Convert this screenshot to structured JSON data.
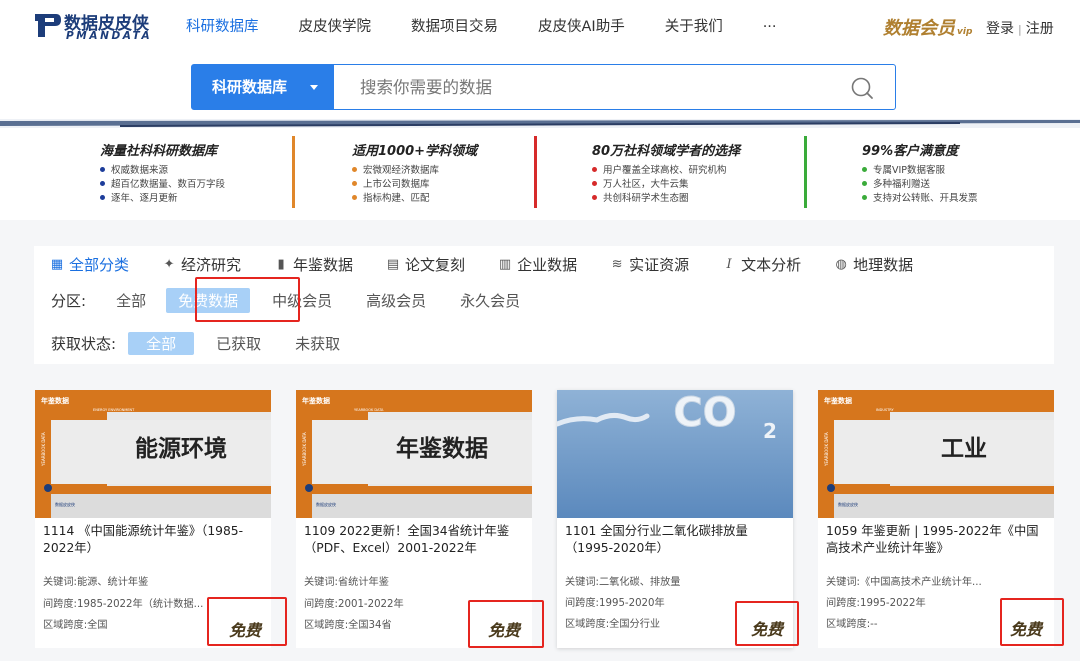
{
  "header": {
    "logo_cn": "数据皮皮侠",
    "logo_en": "PMANDATA",
    "nav": [
      "科研数据库",
      "皮皮侠学院",
      "数据项目交易",
      "皮皮侠AI助手",
      "关于我们",
      "···"
    ],
    "vip_text": "数据会员",
    "vip_sub": "vip",
    "login": "登录",
    "register": "注册"
  },
  "search": {
    "scope": "科研数据库",
    "placeholder": "搜索你需要的数据"
  },
  "features": [
    {
      "title": "海量社科科研数据库",
      "items": [
        "权威数据来源",
        "超百亿数据量、数百万字段",
        "逐年、逐月更新"
      ],
      "color": "#1d3d9a"
    },
    {
      "title": "适用1000+学科领域",
      "items": [
        "宏微观经济数据库",
        "上市公司数据库",
        "指标构建、匹配"
      ],
      "color": "#e0872a"
    },
    {
      "title": "80万社科领域学者的选择",
      "items": [
        "用户覆盖全球高校、研究机构",
        "万人社区，大牛云集",
        "共创科研学术生态圈"
      ],
      "color": "#d62a2a"
    },
    {
      "title": "99%客户满意度",
      "items": [
        "专属VIP数据客服",
        "多种福利赠送",
        "支持对公转账、开具发票"
      ],
      "color": "#3aab3a"
    }
  ],
  "categories": [
    {
      "label": "全部分类",
      "icon": "grid-icon"
    },
    {
      "label": "经济研究",
      "icon": "bulb-icon"
    },
    {
      "label": "年鉴数据",
      "icon": "book-icon"
    },
    {
      "label": "论文复刻",
      "icon": "document-icon"
    },
    {
      "label": "企业数据",
      "icon": "building-icon"
    },
    {
      "label": "实证资源",
      "icon": "layers-icon"
    },
    {
      "label": "文本分析",
      "icon": "text-cursor-icon"
    },
    {
      "label": "地理数据",
      "icon": "globe-icon"
    }
  ],
  "filters": {
    "zone_label": "分区:",
    "zone_options": [
      "全部",
      "免费数据",
      "中级会员",
      "高级会员",
      "永久会员"
    ],
    "status_label": "获取状态:",
    "status_options": [
      "全部",
      "已获取",
      "未获取"
    ]
  },
  "cards": [
    {
      "banner_tag": "年鉴数据",
      "banner_sub": "ENERGY ENVIRONMENT",
      "side_text": "YEARBOOK DATA",
      "cover_title": "能源环境",
      "brand": "数据皮皮侠",
      "title": "1114 《中国能源统计年鉴》（1985-2022年）",
      "keywords": "关键词:能源、统计年鉴",
      "time_span": "间跨度:1985-2022年（统计数据...",
      "region": "区域跨度:全国",
      "badge": "免费"
    },
    {
      "banner_tag": "年鉴数据",
      "banner_sub": "YEARBOOK DATA",
      "side_text": "YEARBOOK DATA",
      "cover_title": "年鉴数据",
      "brand": "数据皮皮侠",
      "title": "1109 2022更新！全国34省统计年鉴（PDF、Excel）2001-2022年",
      "keywords": "关键词:省统计年鉴",
      "time_span": "间跨度:2001-2022年",
      "region": "区域跨度:全国34省",
      "badge": "免费"
    },
    {
      "cover_title": "CO",
      "cover_sub": "2",
      "title": "1101 全国分行业二氧化碳排放量（1995-2020年）",
      "keywords": "关键词:二氧化碳、排放量",
      "time_span": "间跨度:1995-2020年",
      "region": "区域跨度:全国分行业",
      "badge": "免费"
    },
    {
      "banner_tag": "年鉴数据",
      "banner_sub": "INDUSTRY",
      "side_text": "YEARBOOK DATA",
      "cover_title": "工业",
      "brand": "数据皮皮侠",
      "title": "1059 年鉴更新 | 1995-2022年《中国高技术产业统计年鉴》",
      "keywords": "关键词:《中国高技术产业统计年...",
      "time_span": "间跨度:1995-2022年",
      "region": "区域跨度:--",
      "badge": "免费"
    }
  ]
}
